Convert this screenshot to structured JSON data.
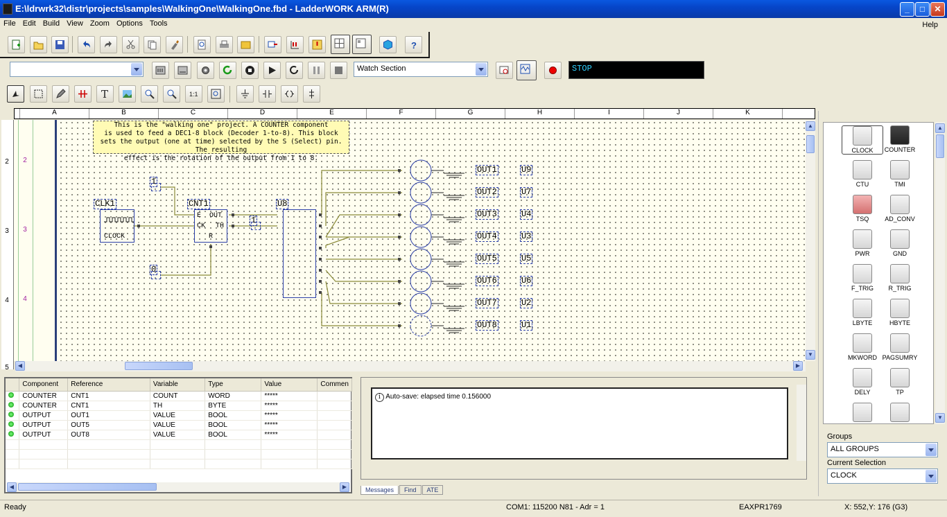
{
  "window": {
    "title": "E:\\ldrwrk32\\distr\\projects\\samples\\WalkingOne\\WalkingOne.fbd - LadderWORK ARM(R)",
    "min_glyph": "_",
    "max_glyph": "□",
    "close_glyph": "✕"
  },
  "menu": {
    "items": [
      "File",
      "Edit",
      "Build",
      "View",
      "Zoom",
      "Options",
      "Tools"
    ],
    "help": "Help"
  },
  "debug_toolbar": {
    "left_combo_value": "",
    "section_combo_value": "Watch Section",
    "status_display": "STOP"
  },
  "columns": [
    "A",
    "B",
    "C",
    "D",
    "E",
    "F",
    "G",
    "H",
    "I",
    "J",
    "K"
  ],
  "rows": {
    "header": [
      "2",
      "3",
      "4",
      "5"
    ],
    "rail": [
      "2",
      "3",
      "4"
    ]
  },
  "diagram": {
    "note_lines": [
      "This is the \"walking one\" project. A COUNTER component",
      "is used to feed  a DEC1-8 block (Decoder 1-to-8). This block",
      "sets the output (one at time) selected by the S (Select) pin. The resulting",
      "effect is the rotation of the output from 1 to 8."
    ],
    "clock_label": "CLK1",
    "clock_text": "CLOCK",
    "counter_label": "CNT1",
    "counter_pins": {
      "e": "E",
      "ck": "CK",
      "r": "R",
      "out": "OUT",
      "th": "TH"
    },
    "decoder_label": "U8",
    "const_one": "1",
    "const_zero": "0",
    "const_mid": "1",
    "outputs": [
      {
        "name": "OUT1",
        "unit": "U9"
      },
      {
        "name": "OUT2",
        "unit": "U7"
      },
      {
        "name": "OUT3",
        "unit": "U4"
      },
      {
        "name": "OUT4",
        "unit": "U3"
      },
      {
        "name": "OUT5",
        "unit": "U5"
      },
      {
        "name": "OUT6",
        "unit": "U6"
      },
      {
        "name": "OUT7",
        "unit": "U2"
      },
      {
        "name": "OUT8",
        "unit": "U1"
      }
    ]
  },
  "palette": {
    "items": [
      {
        "label": "CLOCK",
        "icon": "clock-icon"
      },
      {
        "label": "COUNTER",
        "icon": "counter-icon"
      },
      {
        "label": "CTU",
        "icon": "ctu-icon"
      },
      {
        "label": "TMI",
        "icon": "tmi-icon"
      },
      {
        "label": "TSQ",
        "icon": "tsq-icon"
      },
      {
        "label": "AD_CONV",
        "icon": "ad-conv-icon"
      },
      {
        "label": "PWR",
        "icon": "pwr-icon"
      },
      {
        "label": "GND",
        "icon": "gnd-icon"
      },
      {
        "label": "F_TRIG",
        "icon": "f-trig-icon"
      },
      {
        "label": "R_TRIG",
        "icon": "r-trig-icon"
      },
      {
        "label": "LBYTE",
        "icon": "lbyte-icon"
      },
      {
        "label": "HBYTE",
        "icon": "hbyte-icon"
      },
      {
        "label": "MKWORD",
        "icon": "mkword-icon"
      },
      {
        "label": "PAGSUMRY",
        "icon": "pagsumry-icon"
      },
      {
        "label": "DELY",
        "icon": "dely-icon"
      },
      {
        "label": "TP",
        "icon": "tp-icon"
      },
      {
        "label": "",
        "icon": "ton-icon"
      },
      {
        "label": "",
        "icon": "tof-icon"
      }
    ],
    "groups_label": "Groups",
    "groups_value": "ALL GROUPS",
    "selection_label": "Current Selection",
    "selection_value": "CLOCK"
  },
  "watch": {
    "headers": [
      "Component",
      "Reference",
      "Variable",
      "Type",
      "Value",
      "Commen"
    ],
    "rows": [
      {
        "component": "COUNTER",
        "reference": "CNT1",
        "variable": "COUNT",
        "type": "WORD",
        "value": "*****"
      },
      {
        "component": "COUNTER",
        "reference": "CNT1",
        "variable": "TH",
        "type": "BYTE",
        "value": "*****"
      },
      {
        "component": "OUTPUT",
        "reference": "OUT1",
        "variable": "VALUE",
        "type": "BOOL",
        "value": "*****"
      },
      {
        "component": "OUTPUT",
        "reference": "OUT5",
        "variable": "VALUE",
        "type": "BOOL",
        "value": "*****"
      },
      {
        "component": "OUTPUT",
        "reference": "OUT8",
        "variable": "VALUE",
        "type": "BOOL",
        "value": "*****"
      }
    ]
  },
  "messages": {
    "text": "Auto-save: elapsed time 0.156000",
    "tabs": [
      "Messages",
      "Find",
      "ATE"
    ]
  },
  "status": {
    "ready": "Ready",
    "com": "COM1: 115200 N81 - Adr = 1",
    "device": "EAXPR1769",
    "coords": "X: 552,Y: 176 (G3)"
  },
  "colors": {
    "titlebar": "#0645c8",
    "rail": "#2b3f7a",
    "block_border": "#2b3fa8",
    "wire": "#8a8a3a",
    "status_text": "#2fd0ff"
  }
}
